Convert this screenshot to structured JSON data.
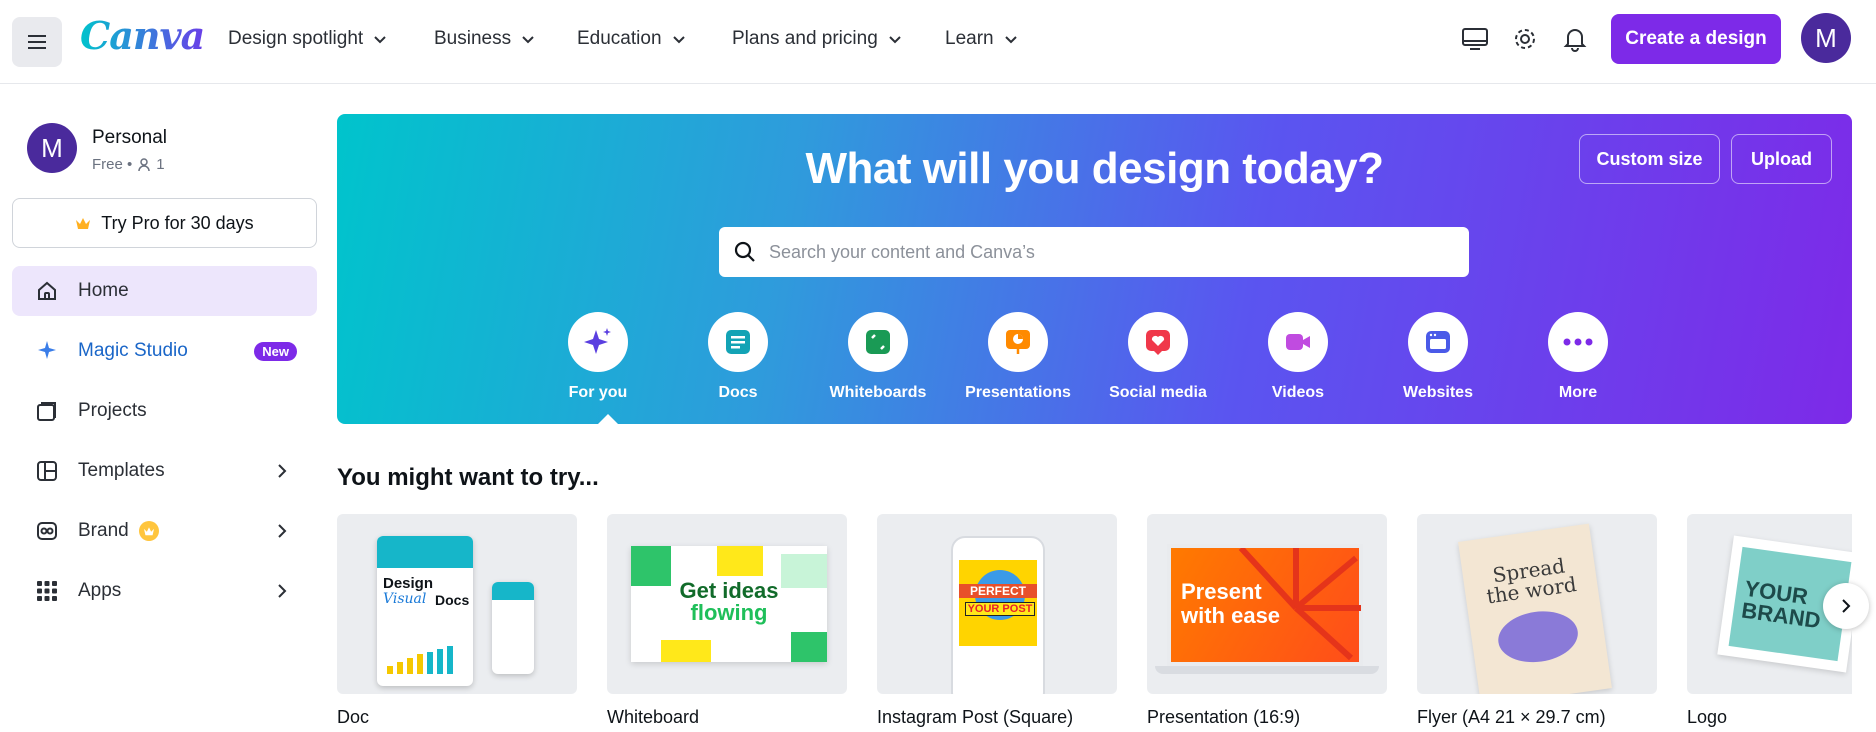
{
  "topbar": {
    "logo": "Canva",
    "nav": [
      {
        "label": "Design spotlight"
      },
      {
        "label": "Business"
      },
      {
        "label": "Education"
      },
      {
        "label": "Plans and pricing"
      },
      {
        "label": "Learn"
      }
    ],
    "create_label": "Create a design",
    "avatar_initial": "M",
    "icons": [
      "menu-icon",
      "desktop-icon",
      "gear-icon",
      "bell-icon"
    ]
  },
  "sidebar": {
    "account": {
      "initial": "M",
      "name": "Personal",
      "plan": "Free •",
      "members": "1"
    },
    "try_pro": "Try Pro for 30 days",
    "items": [
      {
        "label": "Home",
        "icon": "home-icon"
      },
      {
        "label": "Magic Studio",
        "icon": "sparkle-icon",
        "badge": "New"
      },
      {
        "label": "Projects",
        "icon": "folder-icon"
      },
      {
        "label": "Templates",
        "icon": "template-icon"
      },
      {
        "label": "Brand",
        "icon": "brand-icon"
      },
      {
        "label": "Apps",
        "icon": "apps-icon"
      }
    ]
  },
  "hero": {
    "title": "What will you design today?",
    "custom_size": "Custom size",
    "upload": "Upload",
    "search_placeholder": "Search your content and Canva’s",
    "categories": [
      {
        "label": "For you",
        "icon": "sparkle-icon",
        "color": "#5a3fe0"
      },
      {
        "label": "Docs",
        "icon": "doc-icon",
        "color": "#13a3b5"
      },
      {
        "label": "Whiteboards",
        "icon": "whiteboard-icon",
        "color": "#1a9a55"
      },
      {
        "label": "Presentations",
        "icon": "presentation-icon",
        "color": "#ff8a00"
      },
      {
        "label": "Social media",
        "icon": "heart-icon",
        "color": "#f0384a"
      },
      {
        "label": "Videos",
        "icon": "video-icon",
        "color": "#c04be0"
      },
      {
        "label": "Websites",
        "icon": "website-icon",
        "color": "#4a5ae8"
      },
      {
        "label": "More",
        "icon": "more-icon",
        "color": "#7d2ae8"
      }
    ]
  },
  "try_section": {
    "title": "You might want to try...",
    "cards": [
      {
        "label": "Doc",
        "thumb_texts": [
          "Design",
          "Visual",
          "Docs"
        ]
      },
      {
        "label": "Whiteboard",
        "thumb_texts": [
          "Get ideas",
          "flowing"
        ]
      },
      {
        "label": "Instagram Post (Square)",
        "thumb_texts": [
          "PERFECT",
          "YOUR POST"
        ]
      },
      {
        "label": "Presentation (16:9)",
        "thumb_texts": [
          "Present",
          "with ease"
        ]
      },
      {
        "label": "Flyer (A4 21 × 29.7 cm)",
        "thumb_texts": [
          "Spread",
          "the word"
        ]
      },
      {
        "label": "Logo",
        "thumb_texts": [
          "YOUR",
          "BRAND"
        ]
      }
    ]
  },
  "colors": {
    "brand": "#7d2ae8",
    "accent": "#00c4cc",
    "active_bg": "#ede6fc"
  }
}
